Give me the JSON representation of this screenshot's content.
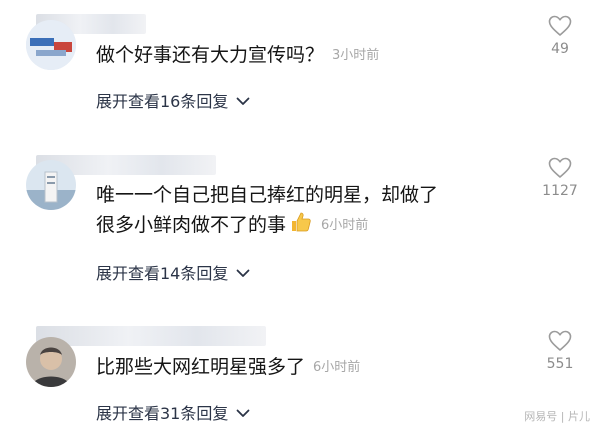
{
  "comments": [
    {
      "text": "做个好事还有大力宣传吗？",
      "time": "3小时前",
      "likes": "49",
      "replies": "展开查看16条回复"
    },
    {
      "text_line1": "唯一一个自己把自己捧红的明星，却做了",
      "text_line2": "很多小鲜肉做不了的事",
      "time": "6小时前",
      "likes": "1127",
      "replies": "展开查看14条回复"
    },
    {
      "text": "比那些大网红明星强多了",
      "time": "6小时前",
      "likes": "551",
      "replies": "展开查看31条回复"
    }
  ],
  "watermark": "网易号 | 片儿",
  "colors": {
    "reply_link": "#2b3447",
    "meta_gray": "#a7a7a7",
    "thumb": "#f2b531"
  }
}
